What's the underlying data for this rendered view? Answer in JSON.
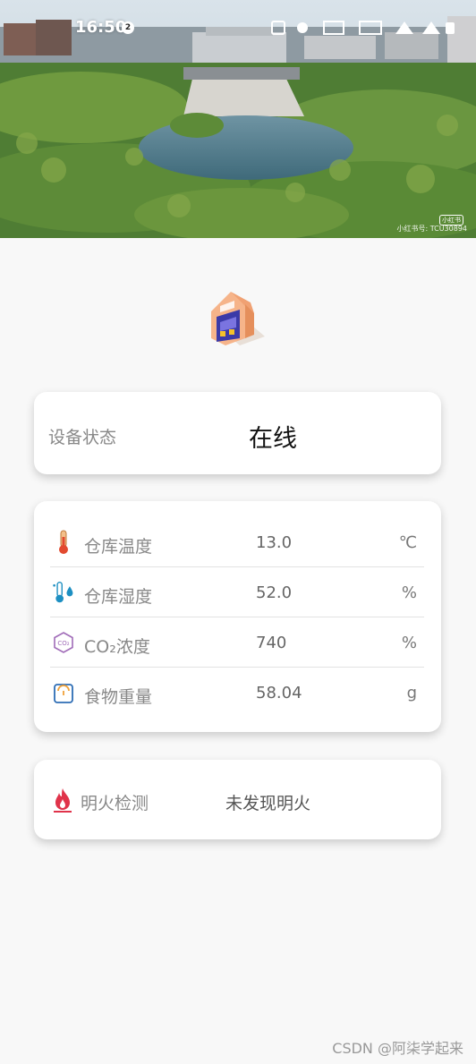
{
  "status_bar": {
    "time": "16:50",
    "notification_count": "2"
  },
  "hero": {
    "photo_badge": "小红书",
    "photo_watermark": "小红书号: TCU30894"
  },
  "device_status": {
    "label": "设备状态",
    "value": "在线"
  },
  "sensors": [
    {
      "icon": "thermometer-icon",
      "label": "仓库温度",
      "value": "13.0",
      "unit": "℃"
    },
    {
      "icon": "humidity-icon",
      "label": "仓库湿度",
      "value": "52.0",
      "unit": "%"
    },
    {
      "icon": "co2-icon",
      "label": "CO₂浓度",
      "value": "740",
      "unit": "%"
    },
    {
      "icon": "scale-icon",
      "label": "食物重量",
      "value": "58.04",
      "unit": "g"
    }
  ],
  "fire_detection": {
    "icon": "flame-icon",
    "label": "明火检测",
    "value": "未发现明火"
  },
  "footer": {
    "watermark": "CSDN @阿柒学起来"
  },
  "colors": {
    "background": "#f8f8f8",
    "card": "#ffffff",
    "accent_orange": "#f5a46b",
    "accent_purple": "#5a4fcf",
    "fire_red": "#e0334a"
  }
}
